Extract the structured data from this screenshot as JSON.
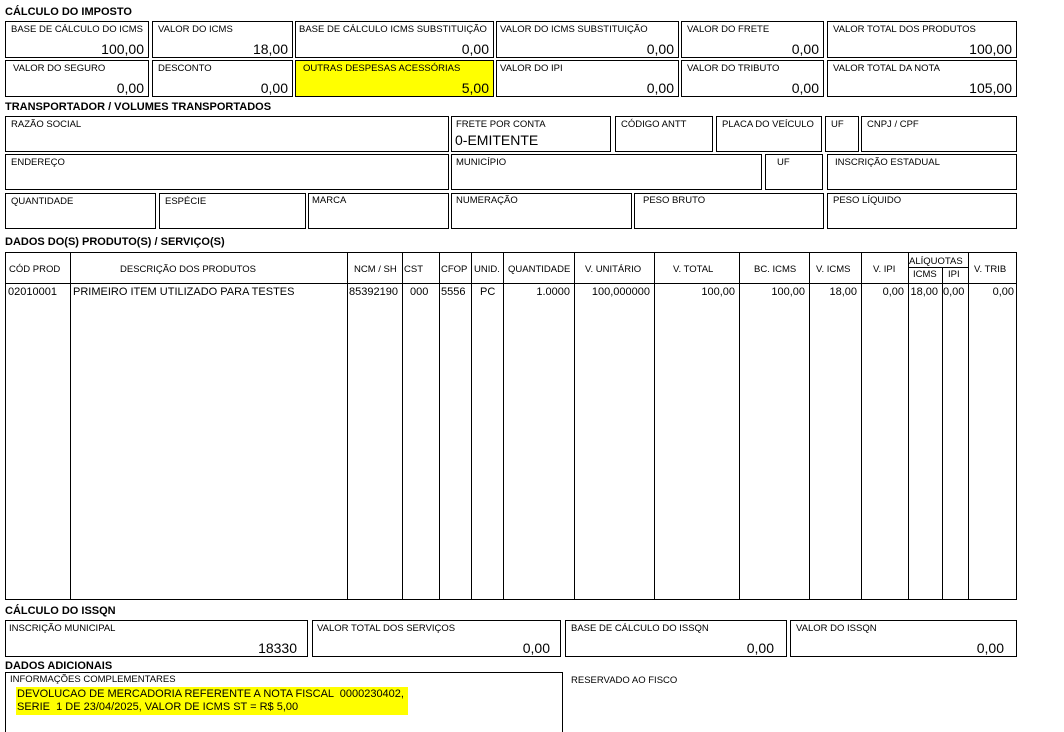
{
  "imposto": {
    "title": "CÁLCULO DO IMPOSTO",
    "row1": [
      {
        "label": "BASE DE CÁLCULO DO ICMS",
        "value": "100,00"
      },
      {
        "label": "VALOR DO ICMS",
        "value": "18,00"
      },
      {
        "label": "BASE DE CÁLCULO ICMS SUBSTITUIÇÃO",
        "value": "0,00"
      },
      {
        "label": "VALOR DO ICMS SUBSTITUIÇÃO",
        "value": "0,00"
      },
      {
        "label": "VALOR DO FRETE",
        "value": "0,00"
      },
      {
        "label": "VALOR TOTAL DOS PRODUTOS",
        "value": "100,00"
      }
    ],
    "row2": [
      {
        "label": "VALOR DO SEGURO",
        "value": "0,00"
      },
      {
        "label": "DESCONTO",
        "value": "0,00"
      },
      {
        "label": "OUTRAS DESPESAS ACESSÓRIAS",
        "value": "5,00"
      },
      {
        "label": "VALOR DO IPI",
        "value": "0,00"
      },
      {
        "label": "VALOR DO TRIBUTO",
        "value": "0,00"
      },
      {
        "label": "VALOR TOTAL DA NOTA",
        "value": "105,00"
      }
    ]
  },
  "transportador": {
    "title": "TRANSPORTADOR / VOLUMES TRANSPORTADOS",
    "razao_social": {
      "label": "RAZÃO SOCIAL",
      "value": ""
    },
    "frete": {
      "label": "FRETE POR CONTA",
      "value": "0-EMITENTE"
    },
    "antt": {
      "label": "CÓDIGO ANTT",
      "value": ""
    },
    "placa": {
      "label": "PLACA DO VEÍCULO",
      "value": ""
    },
    "uf1": {
      "label": "UF",
      "value": ""
    },
    "cnpj": {
      "label": "CNPJ / CPF",
      "value": ""
    },
    "endereco": {
      "label": "ENDEREÇO",
      "value": ""
    },
    "municipio": {
      "label": "MUNICÍPIO",
      "value": ""
    },
    "uf2": {
      "label": "UF",
      "value": ""
    },
    "ie": {
      "label": "INSCRIÇÃO ESTADUAL",
      "value": ""
    },
    "quantidade": {
      "label": "QUANTIDADE",
      "value": ""
    },
    "especie": {
      "label": "ESPÉCIE",
      "value": ""
    },
    "marca": {
      "label": "MARCA",
      "value": ""
    },
    "numeracao": {
      "label": "NUMERAÇÃO",
      "value": ""
    },
    "peso_bruto": {
      "label": "PESO BRUTO",
      "value": ""
    },
    "peso_liquido": {
      "label": "PESO LÍQUIDO",
      "value": ""
    }
  },
  "produtos": {
    "title": "DADOS DO(S) PRODUTO(S) / SERVIÇO(S)",
    "headers": {
      "cod": "CÓD PROD",
      "desc": "DESCRIÇÃO DOS PRODUTOS",
      "ncm": "NCM / SH",
      "cst": "CST",
      "cfop": "CFOP",
      "unid": "UNID.",
      "qtd": "QUANTIDADE",
      "vunit": "V. UNITÁRIO",
      "vtotal": "V. TOTAL",
      "bcicms": "BC. ICMS",
      "vicms": "V. ICMS",
      "vipi": "V. IPI",
      "aliquotas": "ALÍQUOTAS",
      "aicms": "ICMS",
      "aipi": "IPI",
      "vtrib": "V. TRIB"
    },
    "items": [
      {
        "cod": "02010001",
        "desc": "PRIMEIRO ITEM UTILIZADO PARA TESTES",
        "ncm": "85392190",
        "cst": "000",
        "cfop": "5556",
        "unid": "PC",
        "qtd": "1.0000",
        "vunit": "100,000000",
        "vtotal": "100,00",
        "bcicms": "100,00",
        "vicms": "18,00",
        "vipi": "0,00",
        "aicms": "18,00",
        "aipi": "0,00",
        "vtrib": "0,00"
      }
    ]
  },
  "issqn": {
    "title": "CÁLCULO DO ISSQN",
    "fields": [
      {
        "label": "INSCRIÇÃO MUNICIPAL",
        "value": "18330"
      },
      {
        "label": "VALOR TOTAL DOS SERVIÇOS",
        "value": "0,00"
      },
      {
        "label": "BASE DE CÁLCULO DO ISSQN",
        "value": "0,00"
      },
      {
        "label": "VALOR DO ISSQN",
        "value": "0,00"
      }
    ]
  },
  "adicionais": {
    "title": "DADOS ADICIONAIS",
    "info_label": "INFORMAÇÕES COMPLEMENTARES",
    "info_text": "DEVOLUCAO DE MERCADORIA REFERENTE A NOTA FISCAL  0000230402,\nSERIE  1 DE 23/04/2025, VALOR DE ICMS ST = R$ 5,00",
    "fisco_label": "RESERVADO AO FISCO"
  },
  "colors": {
    "highlight": "#ffff00",
    "border": "#000000"
  }
}
